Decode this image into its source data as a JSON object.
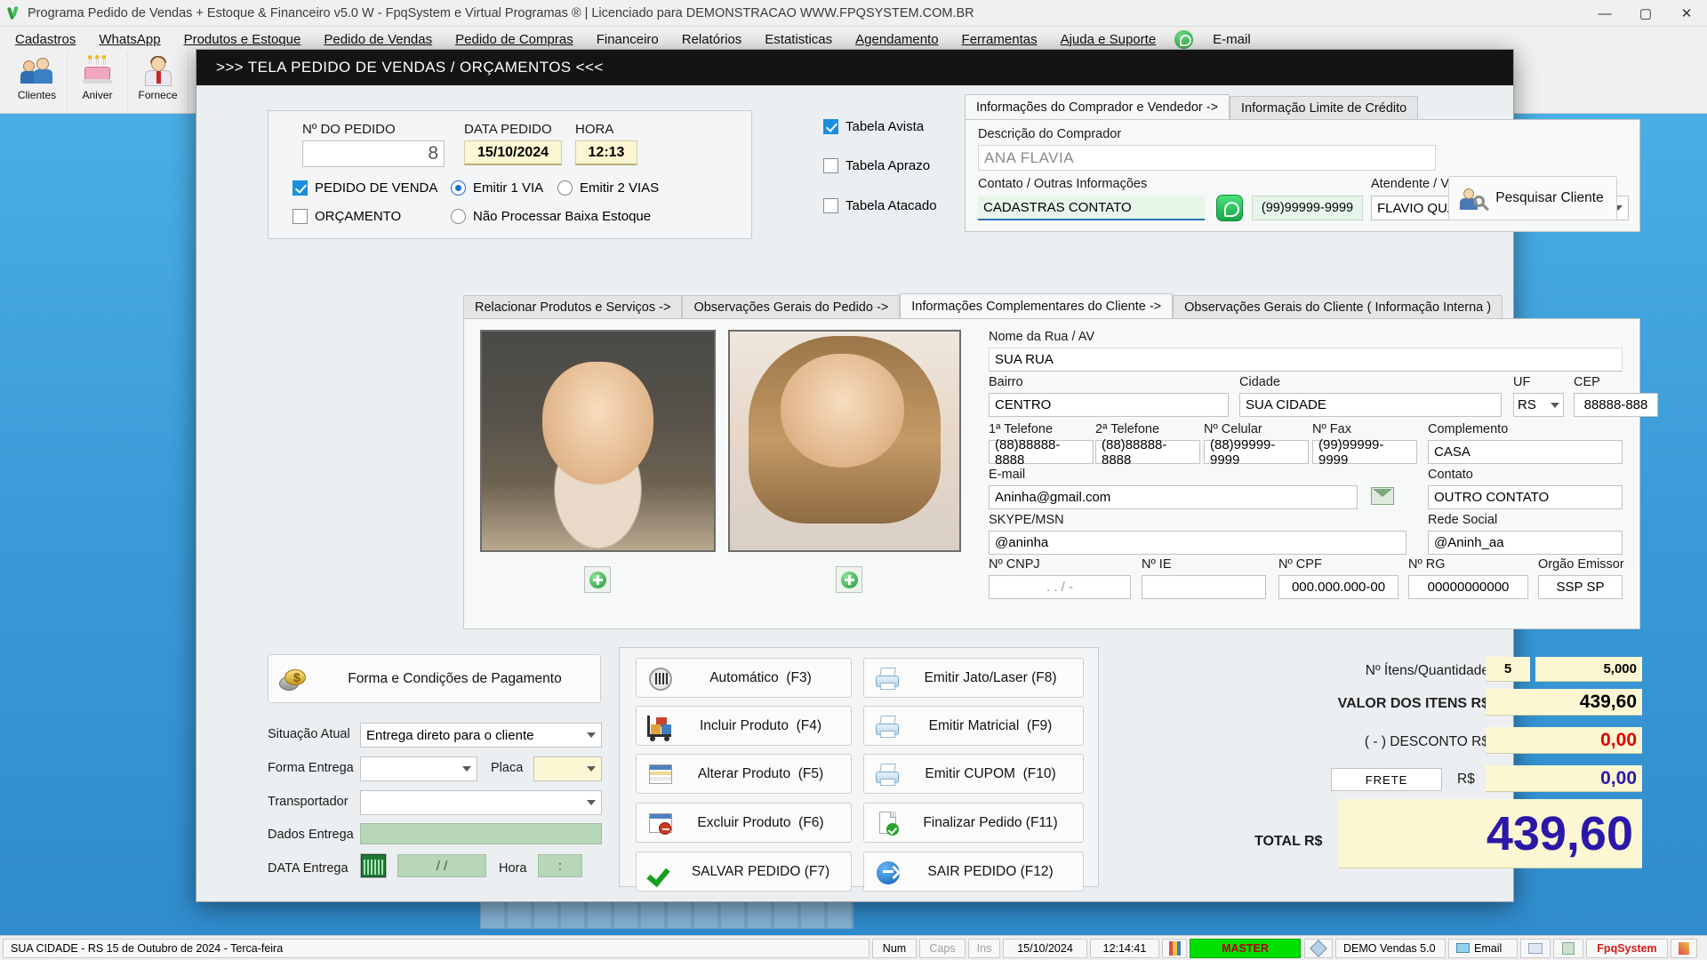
{
  "window": {
    "title": "Programa Pedido de Vendas + Estoque & Financeiro v5.0 W - FpqSystem e Virtual Programas ® | Licenciado para  DEMONSTRACAO WWW.FPQSYSTEM.COM.BR",
    "minimize": "—",
    "maximize": "▢",
    "close": "✕"
  },
  "menu": {
    "items": [
      {
        "label": "Cadastros"
      },
      {
        "label": "WhatsApp"
      },
      {
        "label": "Produtos e Estoque"
      },
      {
        "label": "Pedido de Vendas"
      },
      {
        "label": "Pedido de Compras"
      },
      {
        "label": "Financeiro"
      },
      {
        "label": "Relatórios"
      },
      {
        "label": "Estatisticas"
      },
      {
        "label": "Agendamento"
      },
      {
        "label": "Ferramentas"
      },
      {
        "label": "Ajuda e Suporte"
      },
      {
        "label": "E-mail"
      }
    ]
  },
  "toolbar": {
    "items": [
      {
        "label": "Clientes",
        "icon": "clients-icon"
      },
      {
        "label": "Aniver",
        "icon": "cake-icon"
      },
      {
        "label": "Fornece",
        "icon": "supplier-icon"
      }
    ]
  },
  "dialog": {
    "title": ">>>   TELA PEDIDO DE VENDAS / ORÇAMENTOS   <<<",
    "order": {
      "numero_label": "Nº DO PEDIDO",
      "numero_value": "8",
      "data_label": "DATA PEDIDO",
      "data_value": "15/10/2024",
      "hora_label": "HORA",
      "hora_value": "12:13",
      "pedido_venda_label": "PEDIDO DE VENDA",
      "pedido_venda_checked": true,
      "orcamento_label": "ORÇAMENTO",
      "orcamento_checked": false,
      "emitir1_label": "Emitir 1 VIA",
      "emitir1_checked": true,
      "emitir2_label": "Emitir 2 VIAS",
      "emitir2_checked": false,
      "nao_processar_label": "Não Processar Baixa Estoque",
      "nao_processar_checked": false,
      "tabela_avista_label": "Tabela Avista",
      "tabela_avista_checked": true,
      "tabela_aprazo_label": "Tabela Aprazo",
      "tabela_aprazo_checked": false,
      "tabela_atacado_label": "Tabela Atacado",
      "tabela_atacado_checked": false
    },
    "buyer_tabs": [
      {
        "label": "Informações do Comprador e Vendedor  ->",
        "active": true
      },
      {
        "label": "Informação Limite de Crédito",
        "active": false
      }
    ],
    "buyer": {
      "descricao_label": "Descrição do Comprador",
      "descricao_value": "ANA FLAVIA",
      "contato_label": "Contato / Outras Informações",
      "contato_value": "CADASTRAS CONTATO",
      "whatsapp_number": "(99)99999-9999",
      "atendente_label": "Atendente / Vendedor",
      "atendente_value": "FLAVIO QUADRADO",
      "pesquisar_button": "Pesquisar Cliente"
    },
    "client_tabs": [
      {
        "label": "Relacionar Produtos e Serviços  ->",
        "active": false
      },
      {
        "label": "Observações Gerais do Pedido  ->",
        "active": false
      },
      {
        "label": "Informações Complementares do Cliente  ->",
        "active": true
      },
      {
        "label": "Observações Gerais do Cliente ( Informação Interna )",
        "active": false
      }
    ],
    "client": {
      "rua_label": "Nome da Rua / AV",
      "rua_value": "SUA RUA",
      "bairro_label": "Bairro",
      "bairro_value": "CENTRO",
      "cidade_label": "Cidade",
      "cidade_value": "SUA CIDADE",
      "uf_label": "UF",
      "uf_value": "RS",
      "cep_label": "CEP",
      "cep_value": "88888-888",
      "tel1_label": "1ª Telefone",
      "tel1_value": "(88)88888-8888",
      "tel2_label": "2ª Telefone",
      "tel2_value": "(88)88888-8888",
      "celular_label": "Nº Celular",
      "celular_value": "(88)99999-9999",
      "fax_label": "Nº Fax",
      "fax_value": "(99)99999-9999",
      "complemento_label": "Complemento",
      "complemento_value": "CASA",
      "email_label": "E-mail",
      "email_value": "Aninha@gmail.com",
      "contato_label": "Contato",
      "contato_value": "OUTRO CONTATO",
      "skype_label": "SKYPE/MSN",
      "skype_value": "@aninha",
      "rede_social_label": "Rede Social",
      "rede_social_value": "@Aninh_aa",
      "cnpj_label": "Nº CNPJ",
      "cnpj_value": ".    .    /     -",
      "ie_label": "Nº IE",
      "ie_value": "",
      "cpf_label": "Nº CPF",
      "cpf_value": "000.000.000-00",
      "rg_label": "Nº RG",
      "rg_value": "00000000000",
      "orgao_label": "Orgão Emissor",
      "orgao_value": "SSP SP"
    },
    "payment": {
      "forma_condicoes_button": "Forma e Condições de Pagamento",
      "situacao_label": "Situação Atual",
      "situacao_value": "Entrega direto para o cliente",
      "forma_entrega_label": "Forma Entrega",
      "forma_entrega_value": "",
      "placa_label": "Placa",
      "placa_value": "",
      "transportador_label": "Transportador",
      "transportador_value": "",
      "dados_entrega_label": "Dados Entrega",
      "dados_entrega_value": "",
      "data_entrega_label": "DATA Entrega",
      "data_entrega_value": "/   /",
      "hora_label": "Hora",
      "hora_value": ":"
    },
    "actions_left": [
      {
        "label": "Automático",
        "key": "(F3)",
        "icon": "barcode-icon"
      },
      {
        "label": "Incluir Produto",
        "key": "(F4)",
        "icon": "cart-icon"
      },
      {
        "label": "Alterar Produto",
        "key": "(F5)",
        "icon": "grid-icon"
      },
      {
        "label": "Excluir Produto",
        "key": "(F6)",
        "icon": "grid-minus-icon"
      },
      {
        "label": "SALVAR PEDIDO",
        "key": "(F7)",
        "icon": "check-icon"
      }
    ],
    "actions_right": [
      {
        "label": "Emitir Jato/Laser",
        "key": "(F8)",
        "icon": "printer-icon"
      },
      {
        "label": "Emitir Matricial",
        "key": "(F9)",
        "icon": "printer-icon"
      },
      {
        "label": "Emitir CUPOM",
        "key": "(F10)",
        "icon": "printer-icon"
      },
      {
        "label": "Finalizar Pedido",
        "key": "(F11)",
        "icon": "doc-check-icon"
      },
      {
        "label": "SAIR  PEDIDO",
        "key": "(F12)",
        "icon": "arrow-circle-icon"
      }
    ],
    "totals": {
      "itens_label": "Nº Ítens/Quantidade",
      "itens_count": "5",
      "itens_qty": "5,000",
      "valor_label": "VALOR DOS ITENS R$",
      "valor_value": "439,60",
      "desconto_label": "( - ) DESCONTO R$",
      "desconto_value": "0,00",
      "frete_button": "FRETE",
      "frete_rs_label": "R$",
      "frete_value": "0,00",
      "total_label": "TOTAL R$",
      "total_value": "439,60"
    }
  },
  "statusbar": {
    "left_text": "SUA CIDADE - RS 15 de Outubro de 2024 - Terca-feira",
    "num": "Num",
    "caps": "Caps",
    "ins": "Ins",
    "date": "15/10/2024",
    "time": "12:14:41",
    "master": "MASTER",
    "demo": "DEMO Vendas 5.0",
    "email": "Email",
    "fpq": "FpqSystem"
  },
  "colors": {
    "accent_blue": "#1a8fe0",
    "total_purple": "#2b17a8",
    "discount_red": "#e00000",
    "yellow_field": "#fcf7d2",
    "master_green": "#00e000"
  }
}
